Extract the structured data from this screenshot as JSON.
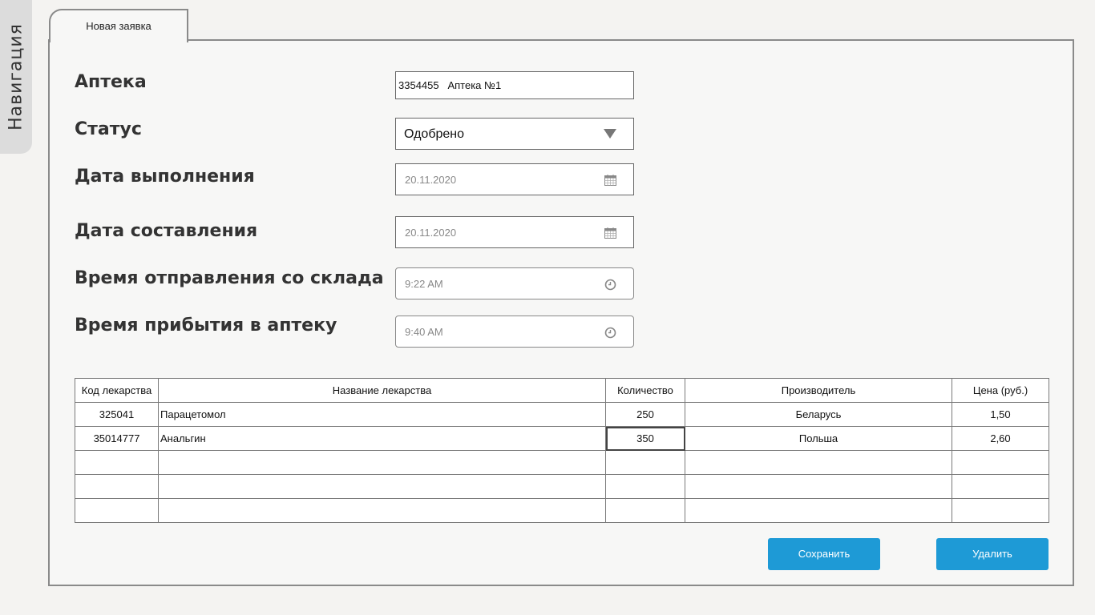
{
  "navigation": {
    "label": "Навигация"
  },
  "tabs": [
    {
      "label": "Новая заявка",
      "active": true
    }
  ],
  "form": {
    "pharmacy": {
      "label": "Аптека",
      "value": "3354455   Аптека №1"
    },
    "status": {
      "label": "Статус",
      "value": "Одобрено"
    },
    "due_date": {
      "label": "Дата выполнения",
      "value": "20.11.2020"
    },
    "created_date": {
      "label": "Дата составления",
      "value": "20.11.2020"
    },
    "departure_time": {
      "label": "Время отправления со склада",
      "value": "9:22 AM"
    },
    "arrival_time": {
      "label": "Время прибытия в аптеку",
      "value": "9:40 AM"
    }
  },
  "table": {
    "columns": [
      "Код лекарства",
      "Название лекарства",
      "Количество",
      "Производитель",
      "Цена (руб.)"
    ],
    "rows": [
      [
        "325041",
        "Парацетомол",
        "250",
        "Беларусь",
        "1,50"
      ],
      [
        "35014777",
        "Анальгин",
        "350",
        "Польша",
        "2,60"
      ],
      [
        "",
        "",
        "",
        "",
        ""
      ],
      [
        "",
        "",
        "",
        "",
        ""
      ],
      [
        "",
        "",
        "",
        "",
        ""
      ]
    ]
  },
  "buttons": {
    "save": "Сохранить",
    "delete": "Удалить"
  },
  "colors": {
    "accent": "#1e9ad6",
    "background": "#f4f3f1",
    "panel": "#f7f7f6",
    "border": "#8a8a8a"
  },
  "icons": {
    "date": "calendar-icon",
    "time": "clock-icon",
    "dropdown": "triangle-down-icon"
  }
}
